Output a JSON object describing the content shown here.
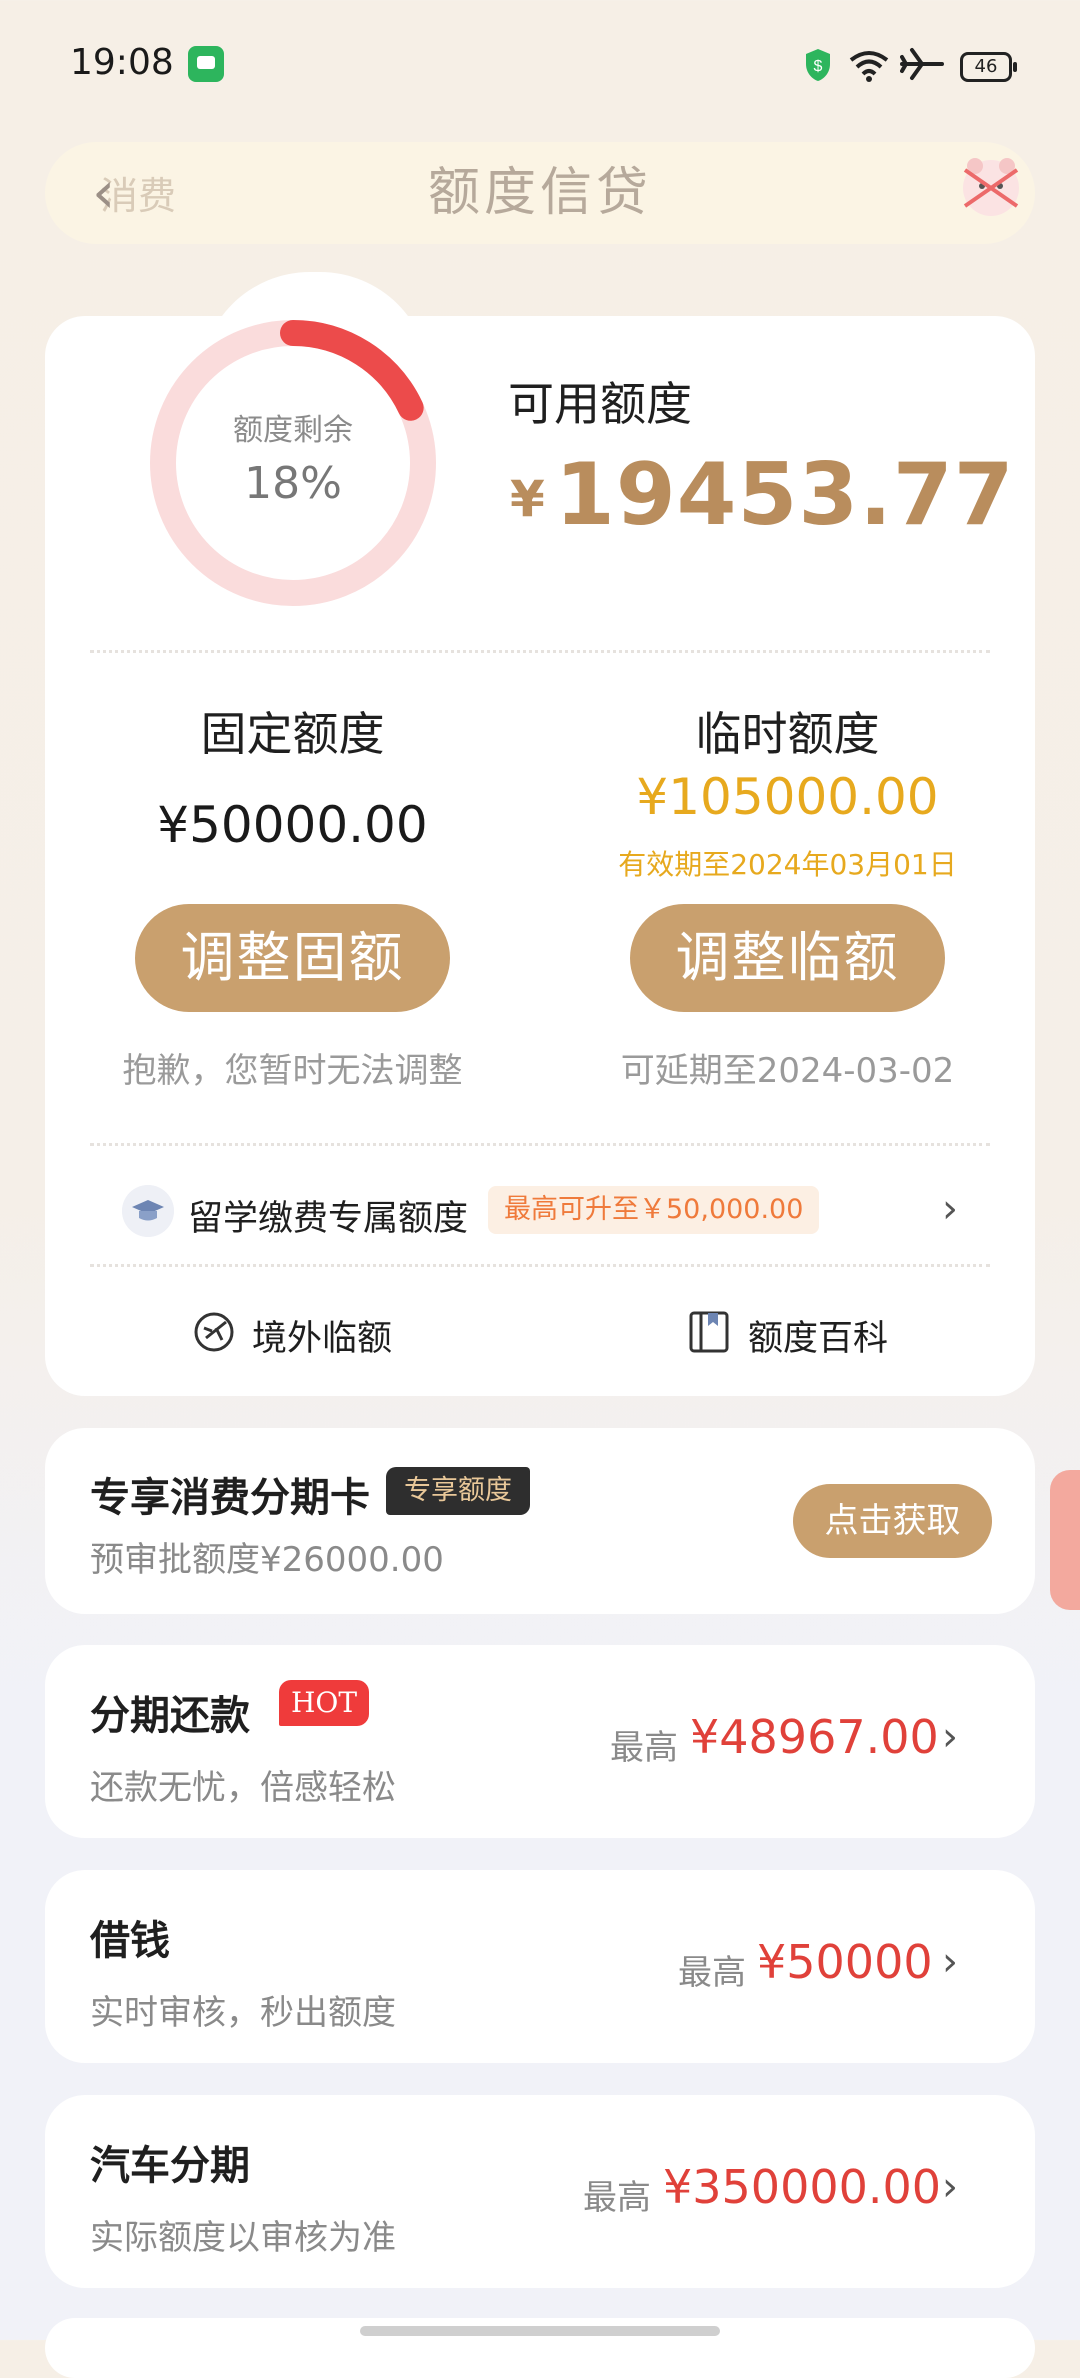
{
  "status_bar": {
    "time": "19:08",
    "battery": "46",
    "icons": [
      "message-icon",
      "shield-icon",
      "wifi-icon",
      "airplane-icon",
      "battery-icon"
    ]
  },
  "header": {
    "title": "额度信贷",
    "ghost_text": "消费"
  },
  "quota": {
    "ring_label": "额度剩余",
    "ring_percent": "18%",
    "remaining_fraction": 0.18,
    "available_label": "可用额度",
    "available_yen": "¥",
    "available_value": "19453.77",
    "fixed_label": "固定额度",
    "fixed_value": "¥50000.00",
    "temp_label": "临时额度",
    "temp_value": "¥105000.00",
    "temp_expiry": "有效期至2024年03月01日",
    "adjust_fixed_label": "调整固额",
    "adjust_temp_label": "调整临额",
    "fixed_note": "抱歉，您暂时无法调整",
    "temp_note": "可延期至2024-03-02",
    "study_label": "留学缴费专属额度",
    "study_badge": "最高可升至￥50,000.00",
    "overseas_label": "境外临额",
    "encyclopedia_label": "额度百科"
  },
  "promo": {
    "title": "专享消费分期卡",
    "badge": "专享额度",
    "subtitle": "预审批额度¥26000.00",
    "button": "点击获取"
  },
  "rows": [
    {
      "title": "分期还款",
      "subtitle": "还款无忧，倍感轻松",
      "prefix": "最高",
      "value": "¥48967.00",
      "badge": "HOT"
    },
    {
      "title": "借钱",
      "subtitle": "实时审核，秒出额度",
      "prefix": "最高",
      "value": "¥50000"
    },
    {
      "title": "汽车分期",
      "subtitle": "实际额度以审核为准",
      "prefix": "最高",
      "value": "¥350000.00"
    }
  ],
  "colors": {
    "gold": "#c9a06e",
    "gold_text": "#b98d5d",
    "temp_yellow": "#e7a91e",
    "red_value": "#e0413a",
    "ring_track": "#fadcdc",
    "ring_fill": "#ec4b4b"
  }
}
